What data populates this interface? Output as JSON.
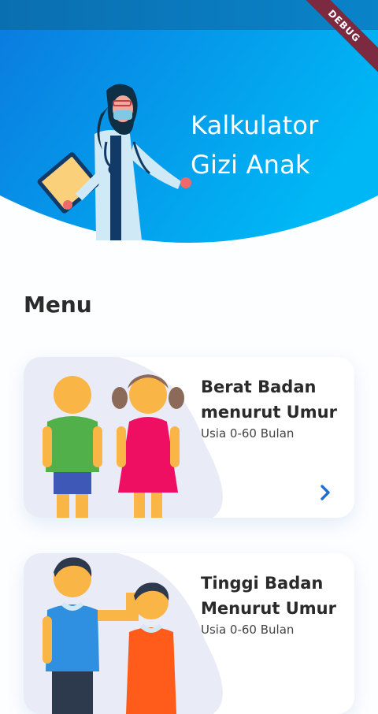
{
  "header": {
    "title_line1": "Kalkulator",
    "title_line2": "Gizi Anak"
  },
  "debug_badge": "DEBUG",
  "menu": {
    "title": "Menu",
    "cards": [
      {
        "title_line1": "Berat Badan",
        "title_line2": "menurut Umur",
        "subtitle": "Usia 0-60 Bulan"
      },
      {
        "title_line1": "Tinggi Badan",
        "title_line2": "Menurut Umur",
        "subtitle": "Usia 0-60 Bulan"
      }
    ]
  },
  "colors": {
    "header_gradient_start": "#0a7de0",
    "header_gradient_end": "#00b7f5",
    "accent": "#1f6fd1",
    "title_text": "#2b2b2b"
  },
  "icons": {
    "card_arrow": "chevron-right-icon"
  }
}
